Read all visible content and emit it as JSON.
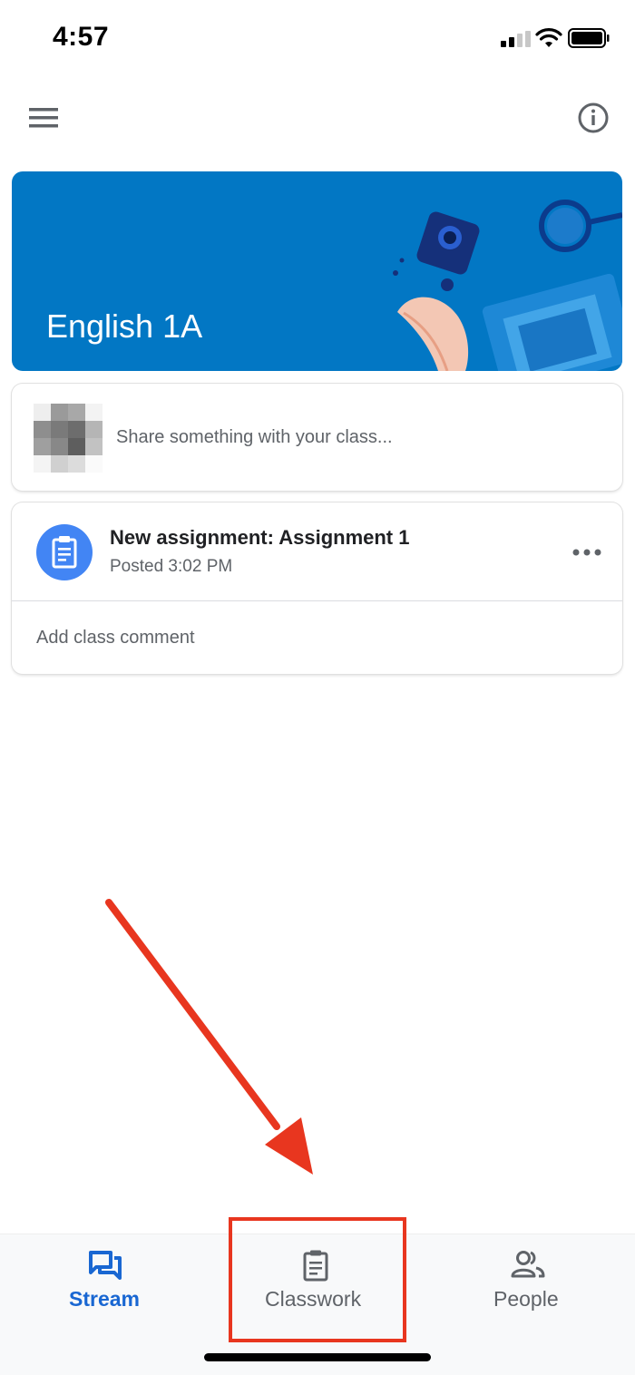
{
  "status_bar": {
    "time": "4:57"
  },
  "app_bar": {
    "menu_icon": "hamburger-menu-icon",
    "info_icon": "info-icon"
  },
  "banner": {
    "class_name": "English 1A",
    "color": "#0277c4"
  },
  "share": {
    "placeholder": "Share something with your class..."
  },
  "posts": [
    {
      "title": "New assignment: Assignment 1",
      "posted": "Posted 3:02 PM",
      "comment_placeholder": "Add class comment",
      "icon": "assignment-icon",
      "icon_color": "#4285f4"
    }
  ],
  "bottom_nav": {
    "tabs": [
      {
        "label": "Stream",
        "icon": "stream-icon",
        "active": true,
        "color": "#1967d2"
      },
      {
        "label": "Classwork",
        "icon": "classwork-icon",
        "active": false,
        "color": "#5f6368"
      },
      {
        "label": "People",
        "icon": "people-icon",
        "active": false,
        "color": "#5f6368"
      }
    ]
  },
  "annotation": {
    "color": "#e8361f",
    "highlighted_tab": "Classwork"
  }
}
